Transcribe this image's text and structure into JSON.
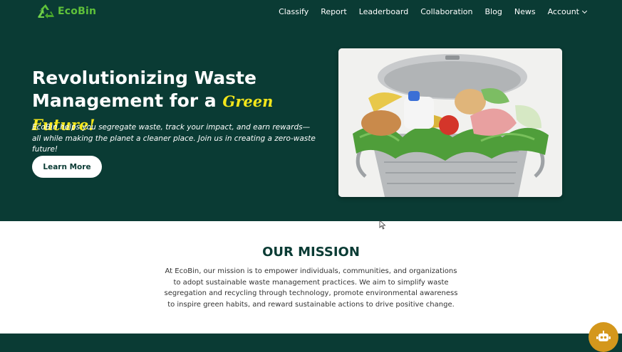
{
  "brand": {
    "name": "EcoBin",
    "logo_icon": "recycle-icon",
    "color": "#5fc23a"
  },
  "nav": {
    "items": [
      {
        "label": "Classify"
      },
      {
        "label": "Report"
      },
      {
        "label": "Leaderboard"
      },
      {
        "label": "Collaboration"
      },
      {
        "label": "Blog"
      },
      {
        "label": "News"
      },
      {
        "label": "Account"
      }
    ],
    "account_icon": "chevron-down-icon"
  },
  "hero": {
    "title_line1": "Revolutionizing Waste",
    "title_line2": "Management for a",
    "title_accent": "Green Future!",
    "description": "EcoBin helps you segregate waste, track your impact, and earn rewards—all while making the planet a cleaner place. Join us in creating a zero-waste future!",
    "cta_label": "Learn More",
    "image_icon": "food-waste-bin-image"
  },
  "mission": {
    "title": "OUR MISSION",
    "text": "At EcoBin, our mission is to empower individuals, communities, and organizations to adopt sustainable waste management practices. We aim to simplify waste segregation and recycling through technology, promote environmental awareness to inspire green habits, and reward sustainable actions to drive positive change."
  },
  "chatbot": {
    "icon": "robot-icon"
  },
  "colors": {
    "primary_dark": "#0a3b34",
    "accent_yellow": "#f3e61b",
    "chat_button": "#d4971c"
  }
}
